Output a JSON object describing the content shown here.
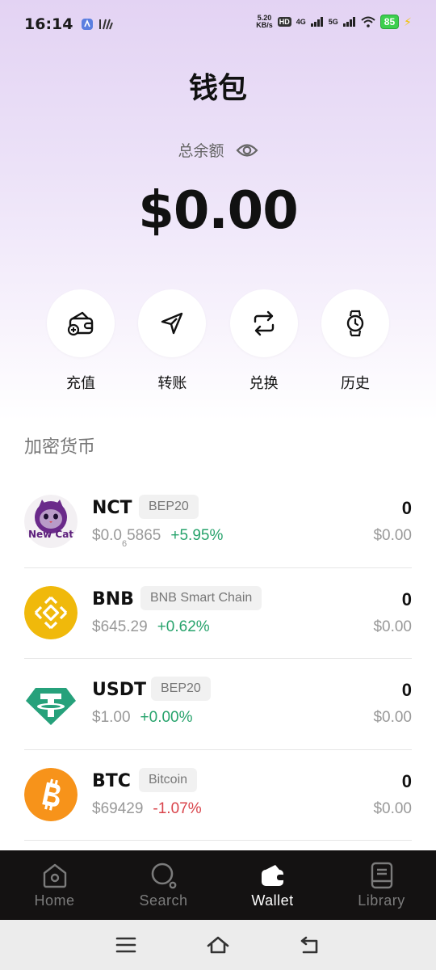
{
  "status_bar": {
    "time": "16:14",
    "net_speed_value": "5.20",
    "net_speed_unit": "KB/s",
    "hd_label": "HD",
    "sim1_label": "4G",
    "sim2_label": "5G",
    "battery": "85"
  },
  "header": {
    "title": "钱包"
  },
  "balance": {
    "label": "总余额",
    "value": "$0.00"
  },
  "actions": [
    {
      "label": "充值",
      "icon": "wallet-add-icon"
    },
    {
      "label": "转账",
      "icon": "send-icon"
    },
    {
      "label": "兑换",
      "icon": "swap-icon"
    },
    {
      "label": "历史",
      "icon": "watch-icon"
    }
  ],
  "section_title": "加密货币",
  "tokens": [
    {
      "symbol": "NCT",
      "chain": "BEP20",
      "price_prefix": "$0.0",
      "price_sub": "6",
      "price_suffix": "5865",
      "change": "+5.95%",
      "amount": "0",
      "value": "$0.00",
      "logo_text": "New Cat",
      "icon": "new-cat-logo"
    },
    {
      "symbol": "BNB",
      "chain": "BNB Smart Chain",
      "price": "$645.29",
      "change": "+0.62%",
      "amount": "0",
      "value": "$0.00",
      "icon": "bnb-logo"
    },
    {
      "symbol": "USDT",
      "chain": "BEP20",
      "price": "$1.00",
      "change": "+0.00%",
      "amount": "0",
      "value": "$0.00",
      "icon": "tether-logo"
    },
    {
      "symbol": "BTC",
      "chain": "Bitcoin",
      "price": "$69429",
      "change": "-1.07%",
      "amount": "0",
      "value": "$0.00",
      "icon": "bitcoin-logo"
    }
  ],
  "bottom_nav": [
    {
      "label": "Home",
      "icon": "home-icon",
      "active": false
    },
    {
      "label": "Search",
      "icon": "search-icon",
      "active": false
    },
    {
      "label": "Wallet",
      "icon": "wallet-icon",
      "active": true
    },
    {
      "label": "Library",
      "icon": "library-icon",
      "active": false
    }
  ],
  "colors": {
    "gradient_top": "#e3d3f3",
    "positive": "#27a36c",
    "negative": "#d9444b",
    "nav_bg": "#141212",
    "bnb": "#f0b90b",
    "usdt": "#26a17b",
    "btc": "#f7931a"
  }
}
